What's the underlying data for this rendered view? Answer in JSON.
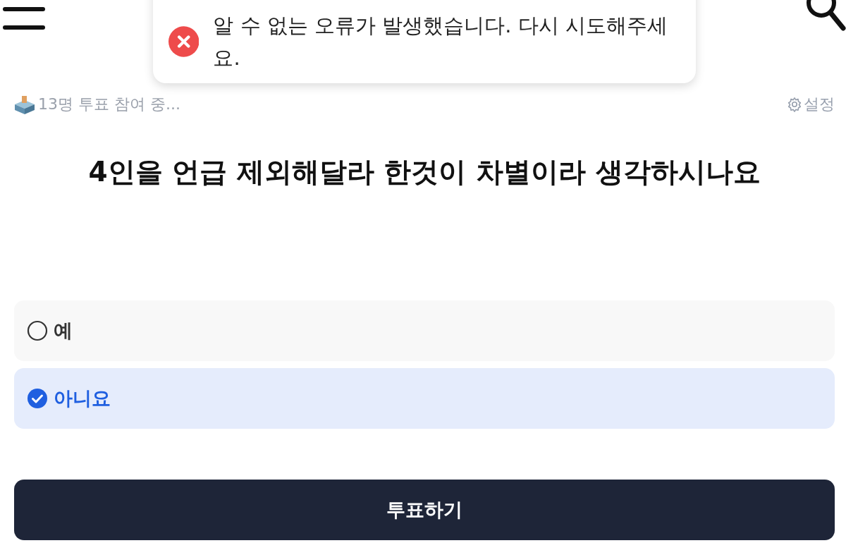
{
  "toast": {
    "kind": "error",
    "message": "알 수 없는 오류가 발생했습니다. 다시 시도해주세요."
  },
  "poll": {
    "participants": "13명 투표 참여 중...",
    "settings": "설정",
    "question": "4인을 언급 제외해달라 한것이 차별이라 생각하시나요",
    "options": [
      {
        "label": "예",
        "selected": false
      },
      {
        "label": "아니요",
        "selected": true
      }
    ],
    "submit": "투표하기"
  }
}
